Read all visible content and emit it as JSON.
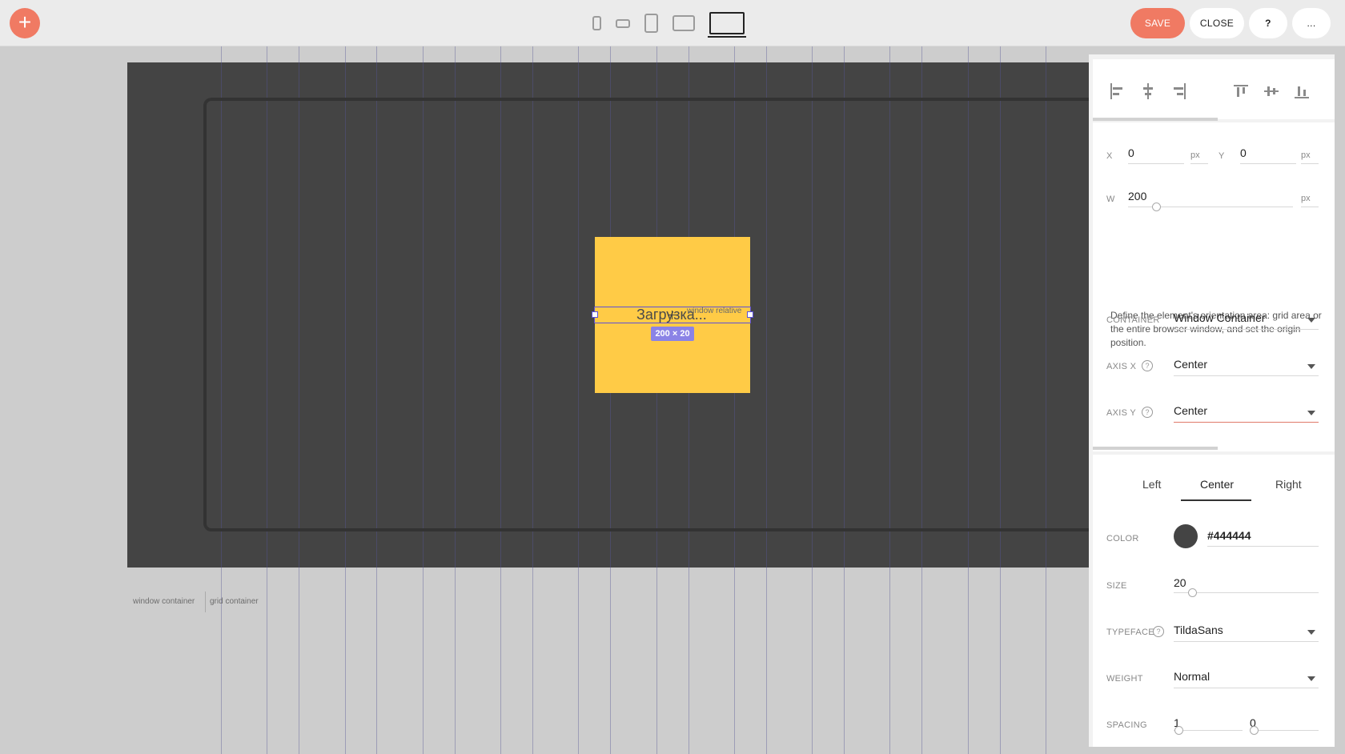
{
  "toolbar": {
    "add_icon": "plus-icon",
    "save_label": "SAVE",
    "close_label": "CLOSE",
    "help_label": "?",
    "more_label": "...",
    "devices": [
      "phone-portrait-icon",
      "phone-landscape-icon",
      "tablet-portrait-icon",
      "tablet-landscape-icon",
      "desktop-icon"
    ],
    "active_device": "desktop-icon"
  },
  "canvas": {
    "background": "#444444",
    "element_text": "Загрузка...",
    "element_fill": "#ffcb46",
    "mode_label": "window relative",
    "size_badge": "200 × 20",
    "container_labels": [
      "window container",
      "grid container"
    ]
  },
  "panel": {
    "align_icons": [
      "align-left-icon",
      "align-center-h-icon",
      "align-right-icon",
      "align-top-icon",
      "align-center-v-icon",
      "align-bottom-icon"
    ],
    "position": {
      "x_label": "X",
      "x_value": "0",
      "x_unit": "px",
      "y_label": "Y",
      "y_value": "0",
      "y_unit": "px",
      "w_label": "W",
      "w_value": "200",
      "w_unit": "px"
    },
    "description": "Define the element's orientation area: grid area or the entire browser window, and set the origin position.",
    "container": {
      "label": "CONTAINER",
      "value": "Window Container"
    },
    "axis_x": {
      "label": "AXIS X",
      "value": "Center"
    },
    "axis_y": {
      "label": "AXIS Y",
      "value": "Center"
    },
    "text_align_tabs": [
      "Left",
      "Center",
      "Right"
    ],
    "active_align_tab": "Center",
    "color": {
      "label": "COLOR",
      "value": "#444444"
    },
    "size": {
      "label": "SIZE",
      "value": "20"
    },
    "typeface": {
      "label": "TYPEFACE",
      "value": "TildaSans"
    },
    "weight": {
      "label": "WEIGHT",
      "value": "Normal"
    },
    "spacing": {
      "label": "SPACING",
      "value_1": "1",
      "value_2": "0"
    }
  }
}
